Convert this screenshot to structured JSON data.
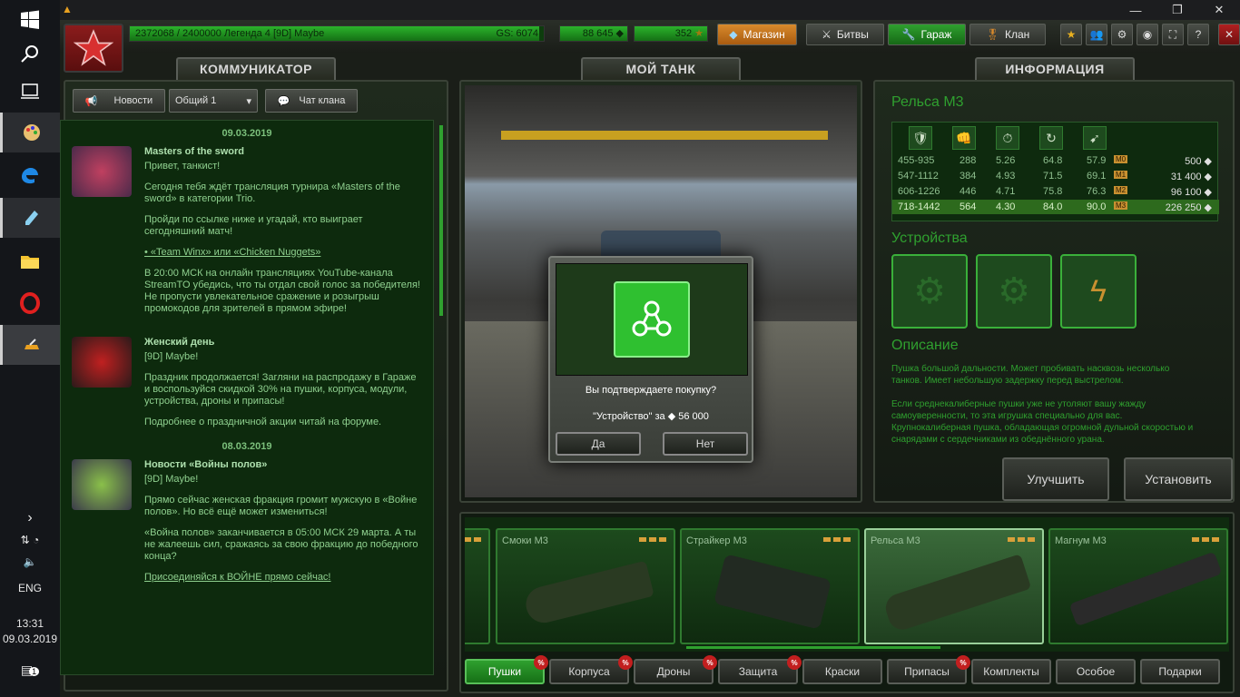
{
  "taskbar": {
    "lang": "ENG",
    "time": "13:31",
    "date": "09.03.2019",
    "notif_count": "1"
  },
  "topbar": {
    "xp_text": "2372068 / 2400000  Легенда 4 [9D] Maybe",
    "xp_progress": 0.988,
    "gs": "GS: 6074",
    "crystals": "88 645",
    "stars": "352",
    "shop": "Магазин",
    "battles": "Битвы",
    "garage": "Гараж",
    "clan": "Клан"
  },
  "communicator": {
    "title": "КОММУНИКАТОР",
    "news_btn": "Новости",
    "channel": "Общий 1",
    "clan_chat": "Чат клана",
    "items": [
      {
        "date": "09.03.2019",
        "title": "Masters of the sword",
        "paragraphs": [
          "Привет, танкист!",
          "Сегодня тебя ждёт трансляция турнира «Masters of the sword» в категории Trio.",
          "Пройди по ссылке ниже и угадай, кто выиграет сегодняшний матч!",
          "• «Team Winx» или «Chicken Nuggets»",
          "В 20:00 МСК на онлайн трансляциях YouTube-канала StreamTO убедись, что ты отдал свой голос за победителя! Не пропусти увлекательное сражение и розыгрыш промокодов для зрителей в прямом эфире!"
        ]
      },
      {
        "date": "",
        "title": "Женский день",
        "paragraphs": [
          "[9D] Maybe!",
          "Праздник продолжается! Загляни на распродажу в Гараже и воспользуйся скидкой 30% на пушки, корпуса, модули, устройства, дроны и припасы!",
          "Подробнее о праздничной акции читай на форуме."
        ]
      },
      {
        "date": "08.03.2019",
        "title": "Новости «Войны полов»",
        "paragraphs": [
          "[9D] Maybe!",
          "Прямо сейчас женская фракция громит мужскую в «Войне полов». Но всё ещё может измениться!",
          "«Война полов» заканчивается в 05:00 МСК 29 марта. А ты не жалеешь сил, сражаясь за свою фракцию до победного конца?",
          "Присоединяйся к ВОЙНЕ прямо сейчас!"
        ]
      }
    ]
  },
  "mytank": {
    "title": "МОЙ ТАНК"
  },
  "dialog": {
    "question": "Вы подтверждаете покупку?",
    "item_line": "\"Устройство\" за ◆ 56 000",
    "yes": "Да",
    "no": "Нет"
  },
  "info": {
    "title": "ИНФОРМАЦИЯ",
    "item_name": "Рельса M3",
    "stat_rows": [
      [
        "455-935",
        "288",
        "5.26",
        "64.8",
        "57.9",
        "M0",
        "500 ◆"
      ],
      [
        "547-1112",
        "384",
        "4.93",
        "71.5",
        "69.1",
        "M1",
        "31 400 ◆"
      ],
      [
        "606-1226",
        "446",
        "4.71",
        "75.8",
        "76.3",
        "M2",
        "96 100 ◆"
      ],
      [
        "718-1442",
        "564",
        "4.30",
        "84.0",
        "90.0",
        "M3",
        "226 250 ◆"
      ]
    ],
    "devices_title": "Устройства",
    "desc_title": "Описание",
    "desc_p1": "Пушка большой дальности. Может пробивать насквозь несколько танков. Имеет небольшую задержку перед выстрелом.",
    "desc_p2": "Если среднекалиберные пушки уже не утоляют вашу жажду самоуверенности, то эта игрушка специально для вас. Крупнокалиберная пушка, обладающая огромной дульной скоростью и снарядами с сердечниками из обеднённого урана.",
    "upgrade": "Улучшить",
    "install": "Установить"
  },
  "garage": {
    "cards": [
      "Смоки M3",
      "Страйкер M3",
      "Рельса M3",
      "Магнум M3"
    ],
    "categories": [
      "Пушки",
      "Корпуса",
      "Дроны",
      "Защита",
      "Краски",
      "Припасы",
      "Комплекты",
      "Особое",
      "Подарки"
    ],
    "sale_mark": "%"
  },
  "colors": {
    "accent": "#2fa02f",
    "rank": "#8a1c1c",
    "shop": "#d88a2c"
  }
}
